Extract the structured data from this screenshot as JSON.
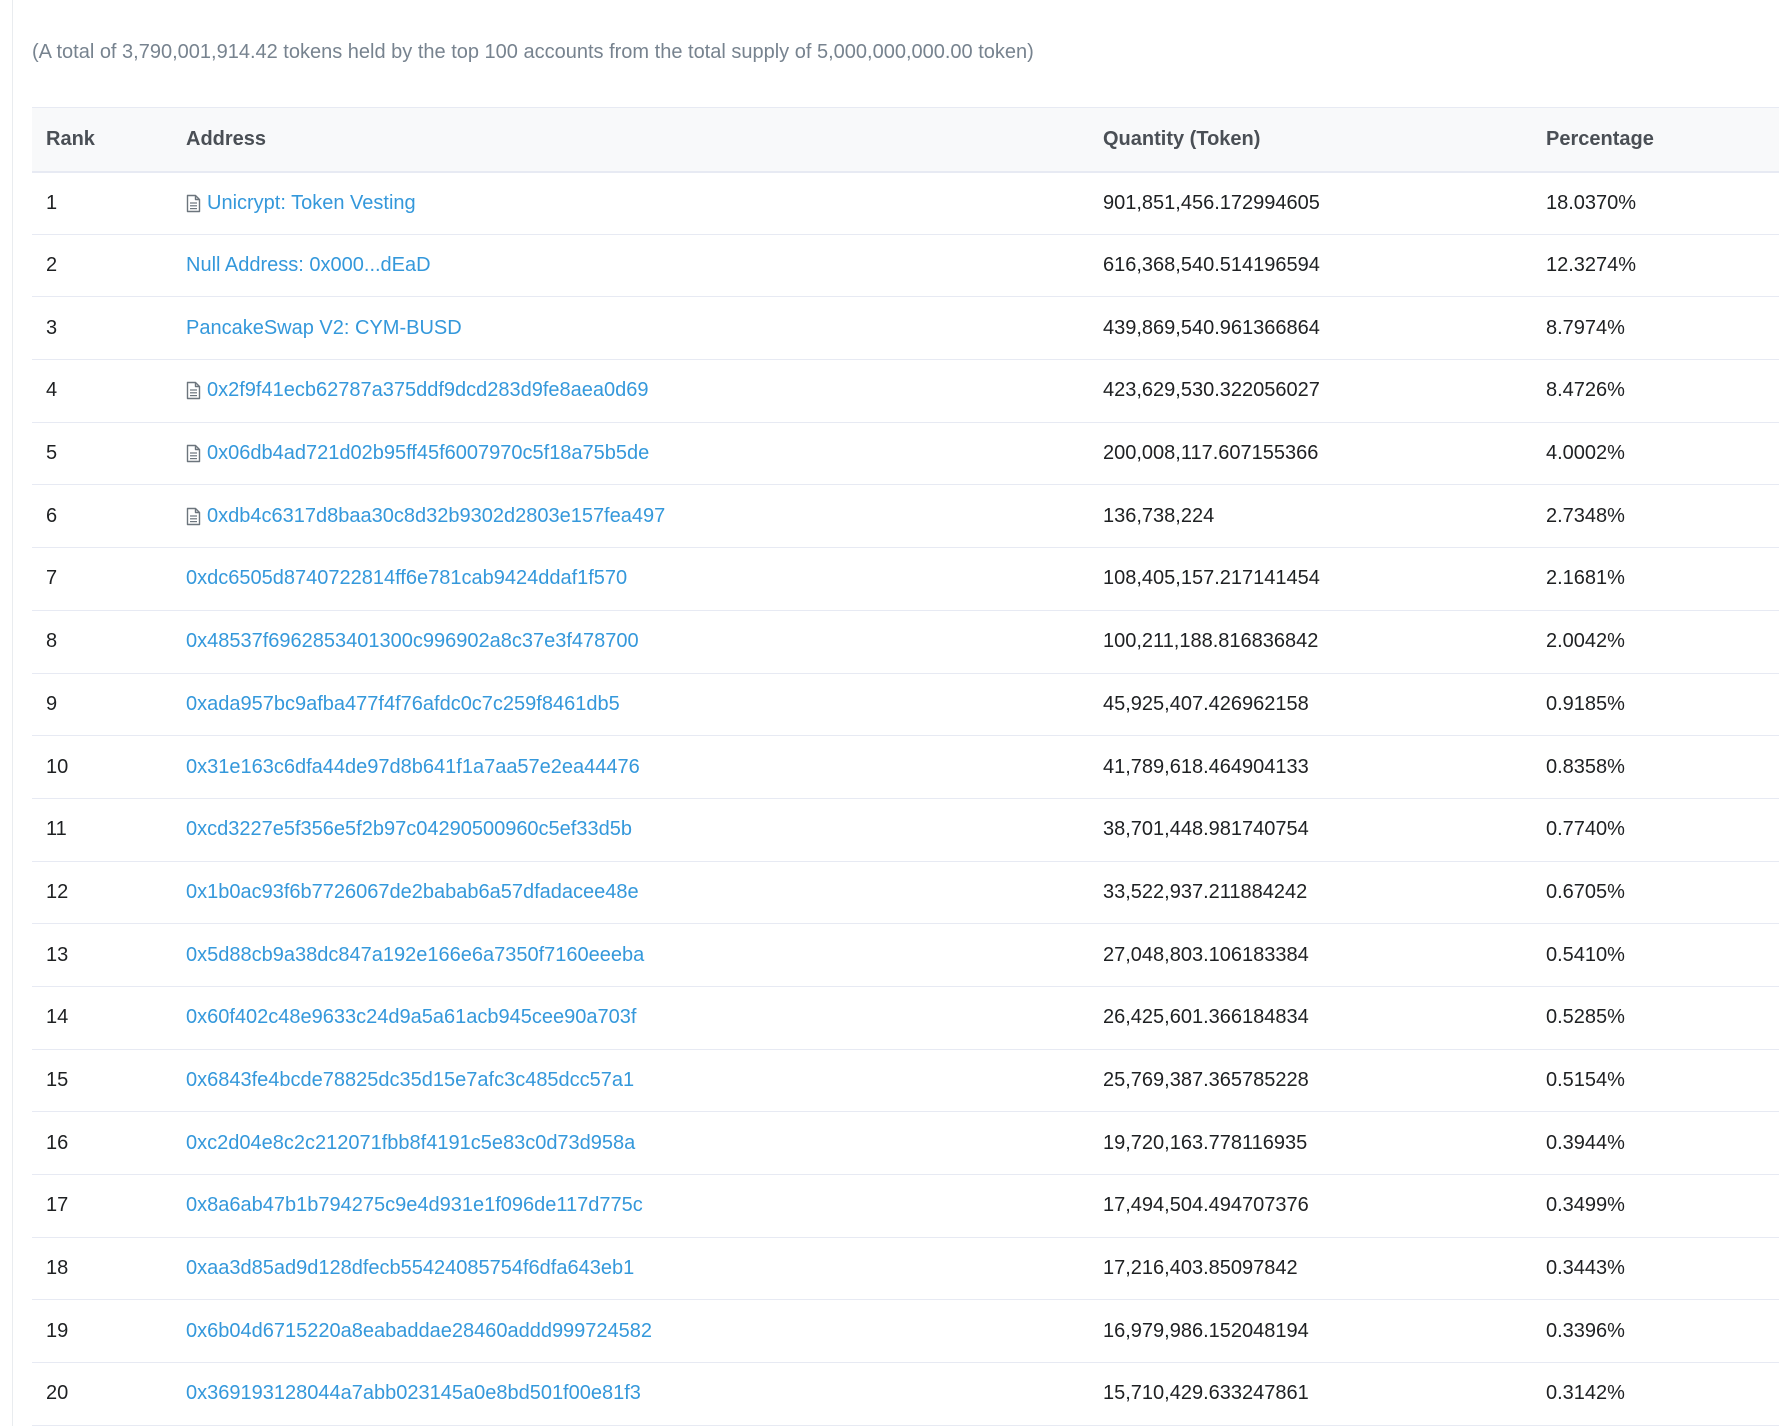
{
  "summary": "(A total of 3,790,001,914.42 tokens held by the top 100 accounts from the total supply of 5,000,000,000.00 token)",
  "table": {
    "headers": {
      "rank": "Rank",
      "address": "Address",
      "quantity": "Quantity (Token)",
      "percentage": "Percentage"
    },
    "rows": [
      {
        "rank": "1",
        "address": "Unicrypt: Token Vesting",
        "is_contract": true,
        "quantity": "901,851,456.172994605",
        "percentage": "18.0370%"
      },
      {
        "rank": "2",
        "address": "Null Address: 0x000...dEaD",
        "is_contract": false,
        "quantity": "616,368,540.514196594",
        "percentage": "12.3274%"
      },
      {
        "rank": "3",
        "address": "PancakeSwap V2: CYM-BUSD",
        "is_contract": false,
        "quantity": "439,869,540.961366864",
        "percentage": "8.7974%"
      },
      {
        "rank": "4",
        "address": "0x2f9f41ecb62787a375ddf9dcd283d9fe8aea0d69",
        "is_contract": true,
        "quantity": "423,629,530.322056027",
        "percentage": "8.4726%"
      },
      {
        "rank": "5",
        "address": "0x06db4ad721d02b95ff45f6007970c5f18a75b5de",
        "is_contract": true,
        "quantity": "200,008,117.607155366",
        "percentage": "4.0002%"
      },
      {
        "rank": "6",
        "address": "0xdb4c6317d8baa30c8d32b9302d2803e157fea497",
        "is_contract": true,
        "quantity": "136,738,224",
        "percentage": "2.7348%"
      },
      {
        "rank": "7",
        "address": "0xdc6505d8740722814ff6e781cab9424ddaf1f570",
        "is_contract": false,
        "quantity": "108,405,157.217141454",
        "percentage": "2.1681%"
      },
      {
        "rank": "8",
        "address": "0x48537f6962853401300c996902a8c37e3f478700",
        "is_contract": false,
        "quantity": "100,211,188.816836842",
        "percentage": "2.0042%"
      },
      {
        "rank": "9",
        "address": "0xada957bc9afba477f4f76afdc0c7c259f8461db5",
        "is_contract": false,
        "quantity": "45,925,407.426962158",
        "percentage": "0.9185%"
      },
      {
        "rank": "10",
        "address": "0x31e163c6dfa44de97d8b641f1a7aa57e2ea44476",
        "is_contract": false,
        "quantity": "41,789,618.464904133",
        "percentage": "0.8358%"
      },
      {
        "rank": "11",
        "address": "0xcd3227e5f356e5f2b97c04290500960c5ef33d5b",
        "is_contract": false,
        "quantity": "38,701,448.981740754",
        "percentage": "0.7740%"
      },
      {
        "rank": "12",
        "address": "0x1b0ac93f6b7726067de2babab6a57dfadacee48e",
        "is_contract": false,
        "quantity": "33,522,937.211884242",
        "percentage": "0.6705%"
      },
      {
        "rank": "13",
        "address": "0x5d88cb9a38dc847a192e166e6a7350f7160eeeba",
        "is_contract": false,
        "quantity": "27,048,803.106183384",
        "percentage": "0.5410%"
      },
      {
        "rank": "14",
        "address": "0x60f402c48e9633c24d9a5a61acb945cee90a703f",
        "is_contract": false,
        "quantity": "26,425,601.366184834",
        "percentage": "0.5285%"
      },
      {
        "rank": "15",
        "address": "0x6843fe4bcde78825dc35d15e7afc3c485dcc57a1",
        "is_contract": false,
        "quantity": "25,769,387.365785228",
        "percentage": "0.5154%"
      },
      {
        "rank": "16",
        "address": "0xc2d04e8c2c212071fbb8f4191c5e83c0d73d958a",
        "is_contract": false,
        "quantity": "19,720,163.778116935",
        "percentage": "0.3944%"
      },
      {
        "rank": "17",
        "address": "0x8a6ab47b1b794275c9e4d931e1f096de117d775c",
        "is_contract": false,
        "quantity": "17,494,504.494707376",
        "percentage": "0.3499%"
      },
      {
        "rank": "18",
        "address": "0xaa3d85ad9d128dfecb55424085754f6dfa643eb1",
        "is_contract": false,
        "quantity": "17,216,403.85097842",
        "percentage": "0.3443%"
      },
      {
        "rank": "19",
        "address": "0x6b04d6715220a8eabaddae28460addd999724582",
        "is_contract": false,
        "quantity": "16,979,986.152048194",
        "percentage": "0.3396%"
      },
      {
        "rank": "20",
        "address": "0x369193128044a7abb023145a0e8bd501f00e81f3",
        "is_contract": false,
        "quantity": "15,710,429.633247861",
        "percentage": "0.3142%"
      }
    ]
  },
  "colors": {
    "link": "#3498db",
    "text": "#1e2022",
    "muted": "#77838f",
    "header_bg": "#f8f9fa",
    "border": "#e7eaf3"
  },
  "icons": {
    "contract": "file-text-icon"
  }
}
